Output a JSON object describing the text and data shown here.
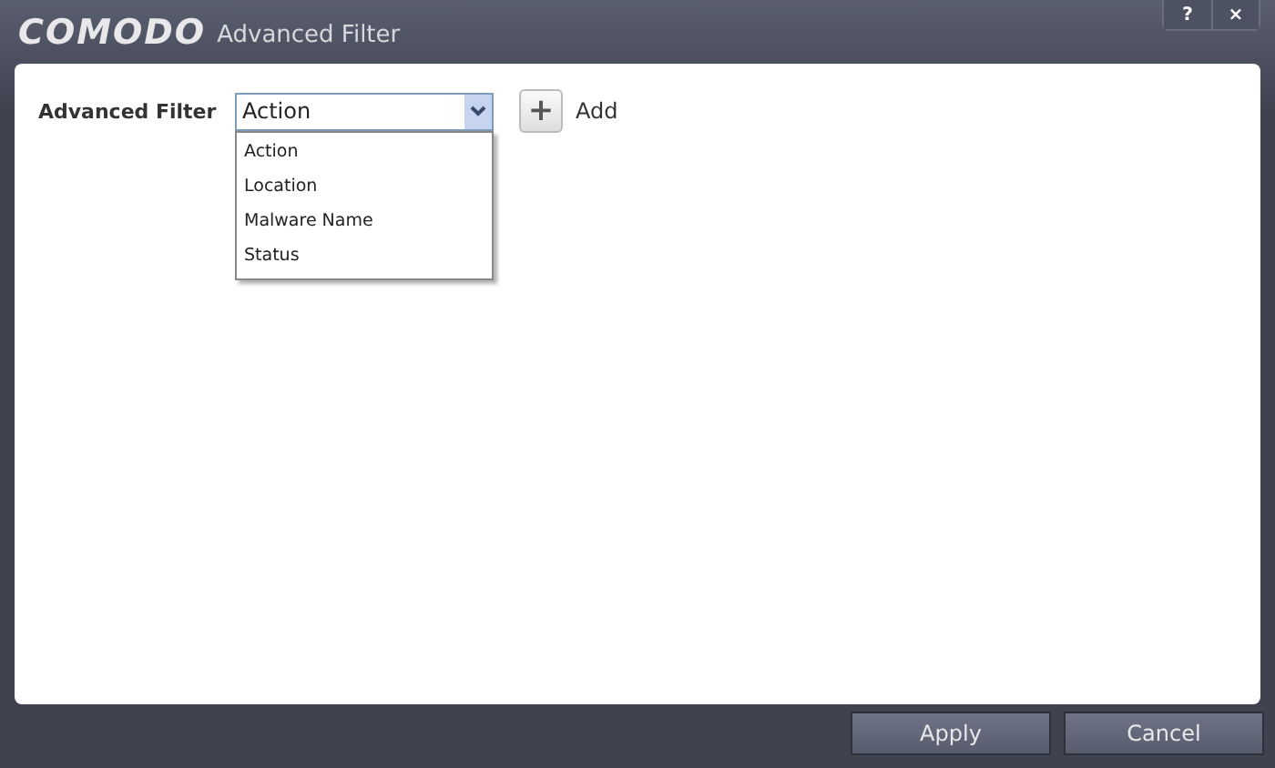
{
  "window": {
    "logo": "COMODO",
    "title": "Advanced Filter",
    "controls": [
      "?",
      "×"
    ]
  },
  "filter": {
    "label": "Advanced Filter",
    "value": "Action",
    "expanded": true,
    "options": [
      "Action",
      "Location",
      "Malware Name",
      "Status"
    ]
  },
  "add_button": {
    "icon": "+",
    "label": "Add"
  },
  "buttons": [
    "Apply",
    "Cancel"
  ]
}
